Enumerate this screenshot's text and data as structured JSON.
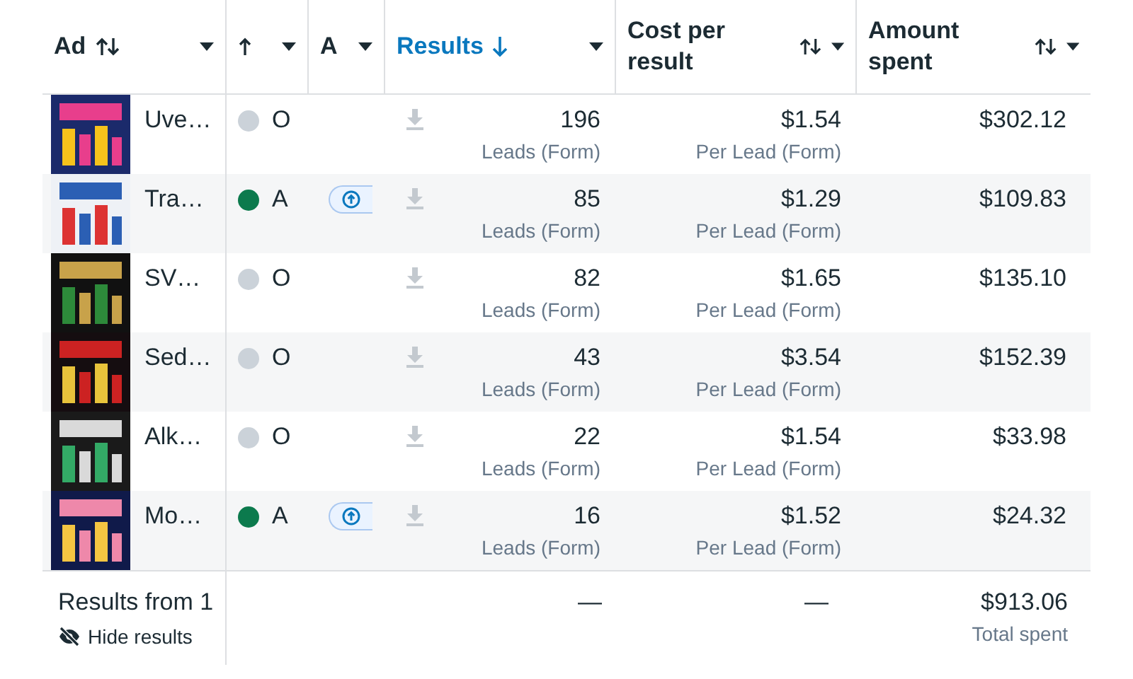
{
  "table": {
    "columns": [
      {
        "label": "Ad",
        "kind": "sort"
      },
      {
        "kind": "uparrow"
      },
      {
        "label": "A",
        "kind": "plain"
      },
      {
        "label": "Results",
        "kind": "sorted"
      },
      {
        "label": "Cost per result",
        "kind": "sort"
      },
      {
        "label": "Amount spent",
        "kind": "sort"
      }
    ],
    "rows": [
      {
        "name": "Uve…",
        "status": "O",
        "color": "#cbd2d9",
        "boost": false,
        "results": "196",
        "results_type": "Leads (Form)",
        "cost": "$1.54",
        "cost_type": "Per Lead (Form)",
        "spent": "$302.12"
      },
      {
        "name": "Tra…",
        "status": "A",
        "color": "#0c7a4d",
        "boost": true,
        "results": "85",
        "results_type": "Leads (Form)",
        "cost": "$1.29",
        "cost_type": "Per Lead (Form)",
        "spent": "$109.83"
      },
      {
        "name": "SV…",
        "status": "O",
        "color": "#cbd2d9",
        "boost": false,
        "results": "82",
        "results_type": "Leads (Form)",
        "cost": "$1.65",
        "cost_type": "Per Lead (Form)",
        "spent": "$135.10"
      },
      {
        "name": "Sed…",
        "status": "O",
        "color": "#cbd2d9",
        "boost": false,
        "results": "43",
        "results_type": "Leads (Form)",
        "cost": "$3.54",
        "cost_type": "Per Lead (Form)",
        "spent": "$152.39"
      },
      {
        "name": "Alk…",
        "status": "O",
        "color": "#cbd2d9",
        "boost": false,
        "results": "22",
        "results_type": "Leads (Form)",
        "cost": "$1.54",
        "cost_type": "Per Lead (Form)",
        "spent": "$33.98"
      },
      {
        "name": "Mo…",
        "status": "A",
        "color": "#0c7a4d",
        "boost": true,
        "results": "16",
        "results_type": "Leads (Form)",
        "cost": "$1.52",
        "cost_type": "Per Lead (Form)",
        "spent": "$24.32"
      }
    ],
    "footer": {
      "label": "Results from 1",
      "hide_link": "Hide results",
      "results": "—",
      "cost": "—",
      "spent": "$913.06",
      "spent_label": "Total spent"
    }
  }
}
